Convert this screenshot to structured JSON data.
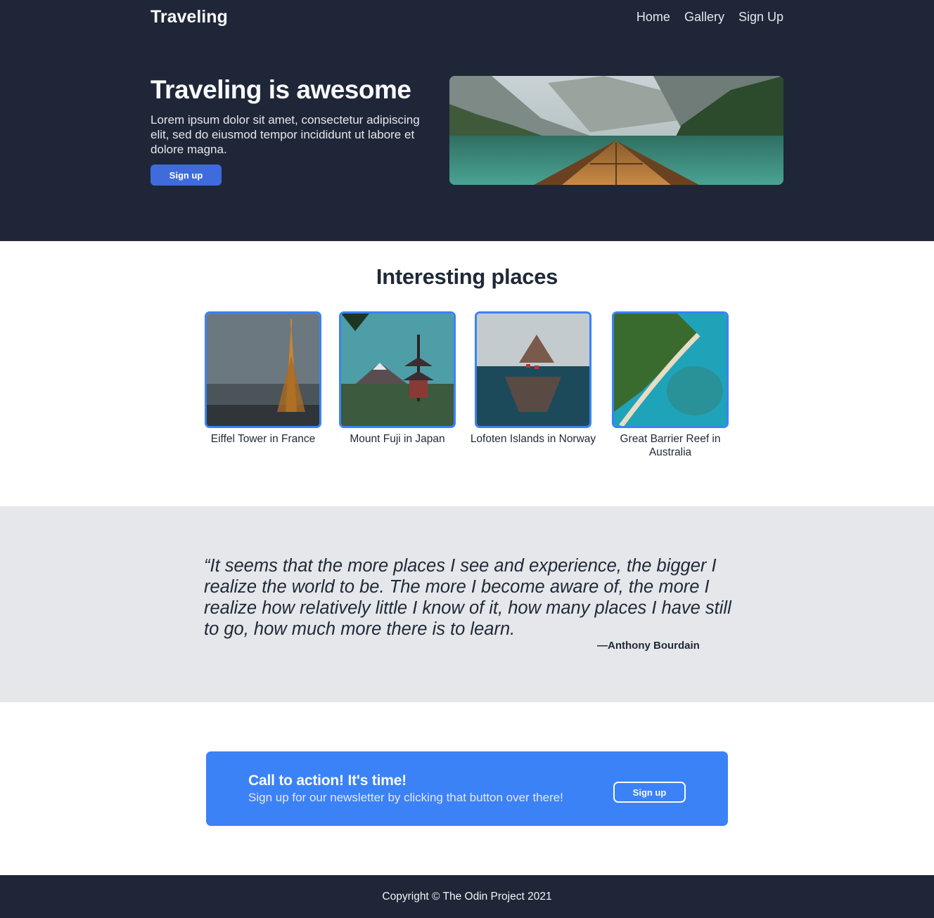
{
  "header": {
    "logo": "Traveling",
    "nav": [
      "Home",
      "Gallery",
      "Sign Up"
    ]
  },
  "hero": {
    "title": "Traveling is awesome",
    "subtitle": "Lorem ipsum dolor sit amet, consectetur adipiscing elit, sed do eiusmod tempor incididunt ut labore et dolore magna.",
    "button": "Sign up"
  },
  "places": {
    "title": "Interesting places",
    "items": [
      {
        "caption": "Eiffel Tower in France"
      },
      {
        "caption": "Mount Fuji in Japan"
      },
      {
        "caption": "Lofoten Islands in Norway"
      },
      {
        "caption": "Great Barrier Reef in Australia"
      }
    ]
  },
  "quote": {
    "text": "“It seems that the more places I see and experience, the bigger I realize the world to be. The more I become aware of, the more I realize how relatively little I know of it, how many places I have still to go, how much more there is to learn.",
    "author": "—Anthony Bourdain"
  },
  "cta": {
    "title": "Call to action! It's time!",
    "subtitle": "Sign up for our newsletter by clicking that button over there!",
    "button": "Sign up"
  },
  "footer": {
    "text": "Copyright © The Odin Project 2021"
  },
  "colors": {
    "dark": "#1f2638",
    "accent": "#3b82f6",
    "hero_button": "#3f6bdd",
    "quote_bg": "#e5e7eb"
  }
}
